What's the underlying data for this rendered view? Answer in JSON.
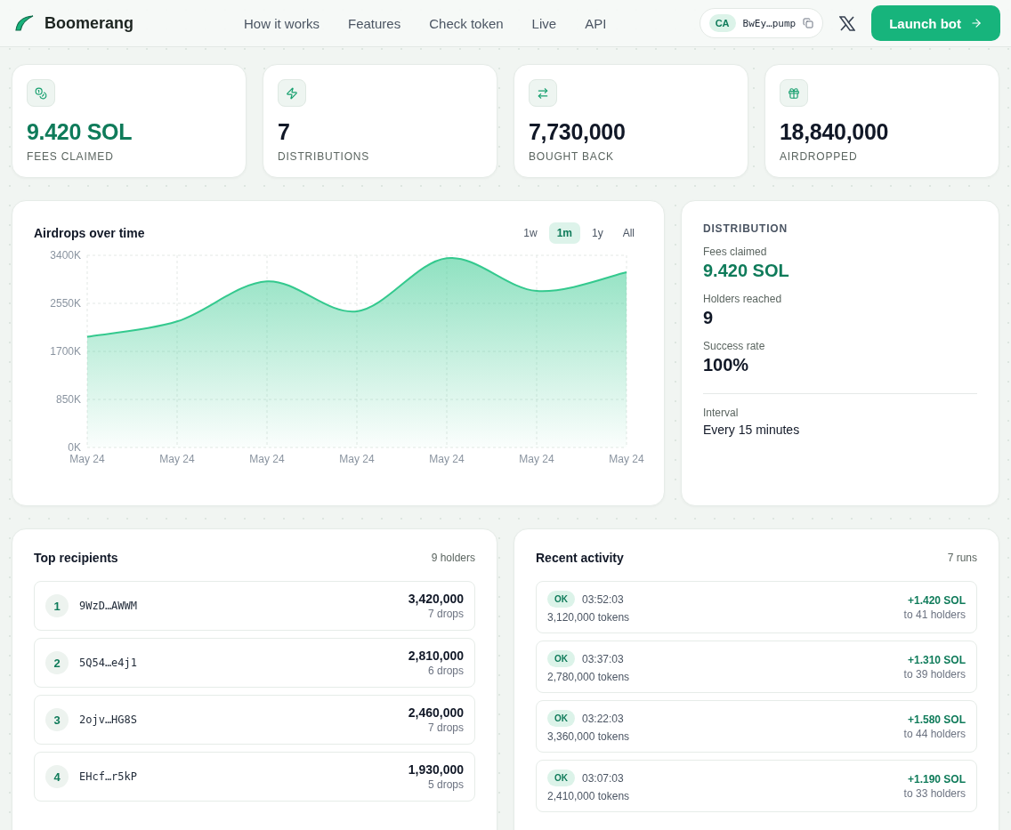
{
  "header": {
    "brand": "Boomerang",
    "nav": [
      {
        "label": "How it works"
      },
      {
        "label": "Features"
      },
      {
        "label": "Check token"
      },
      {
        "label": "Live"
      },
      {
        "label": "API"
      }
    ],
    "contract": {
      "badge": "CA",
      "address": "BwEy…pump"
    },
    "launch_button": "Launch bot"
  },
  "stats": [
    {
      "kind": "coins",
      "value": "9.420 SOL",
      "label": "FEES CLAIMED",
      "color": "#0f7b5a"
    },
    {
      "kind": "zap",
      "value": "7",
      "label": "DISTRIBUTIONS",
      "color": "#111827"
    },
    {
      "kind": "swap",
      "value": "7,730,000",
      "label": "BOUGHT BACK",
      "color": "#111827"
    },
    {
      "kind": "gift",
      "value": "18,840,000",
      "label": "AIRDROPPED",
      "color": "#111827"
    }
  ],
  "chart_card": {
    "title": "Airdrops over time",
    "ranges": [
      {
        "label": "1w",
        "selected": false
      },
      {
        "label": "1m",
        "selected": true
      },
      {
        "label": "1y",
        "selected": false
      },
      {
        "label": "All",
        "selected": false
      }
    ],
    "chart_data": {
      "type": "area",
      "categories": [
        "May 24",
        "May 24",
        "May 24",
        "May 24",
        "May 24",
        "May 24",
        "May 24"
      ],
      "grid": true,
      "series": [
        {
          "color": "#34c98e",
          "values": [
            1960,
            2230,
            2940,
            2410,
            3350,
            2770,
            3100
          ]
        }
      ],
      "ylim": [
        0,
        3400
      ],
      "yticks": [
        {
          "value": 0,
          "label": "0K"
        },
        {
          "value": 850,
          "label": "850K"
        },
        {
          "value": 1700,
          "label": "1700K"
        },
        {
          "value": 2550,
          "label": "2550K"
        },
        {
          "value": 3400,
          "label": "3400K"
        }
      ]
    }
  },
  "distribution": {
    "title": "DISTRIBUTION",
    "metrics": [
      {
        "label": "Fees claimed",
        "value": "9.420 SOL",
        "color": "#0f7b5a"
      },
      {
        "label": "Holders reached",
        "value": "9",
        "color": "#111827"
      },
      {
        "label": "Success rate",
        "value": "100%",
        "color": "#111827"
      }
    ],
    "interval": {
      "label": "Interval",
      "value": "Every 15 minutes"
    }
  },
  "recipients": {
    "title": "Top recipients",
    "count": "9 holders",
    "items": [
      {
        "rank": "1",
        "address": "9WzD…AWWM",
        "amount": "3,420,000",
        "drops": "7 drops"
      },
      {
        "rank": "2",
        "address": "5Q54…e4j1",
        "amount": "2,810,000",
        "drops": "6 drops"
      },
      {
        "rank": "3",
        "address": "2ojv…HG8S",
        "amount": "2,460,000",
        "drops": "7 drops"
      },
      {
        "rank": "4",
        "address": "EHcf…r5kP",
        "amount": "1,930,000",
        "drops": "5 drops"
      }
    ]
  },
  "activity": {
    "title": "Recent activity",
    "count": "7 runs",
    "items": [
      {
        "status": "OK",
        "time": "03:52:03",
        "tokens": "3,120,000 tokens",
        "sol": "+1.420 SOL",
        "holders": "to 41 holders"
      },
      {
        "status": "OK",
        "time": "03:37:03",
        "tokens": "2,780,000 tokens",
        "sol": "+1.310 SOL",
        "holders": "to 39 holders"
      },
      {
        "status": "OK",
        "time": "03:22:03",
        "tokens": "3,360,000 tokens",
        "sol": "+1.580 SOL",
        "holders": "to 44 holders"
      },
      {
        "status": "OK",
        "time": "03:07:03",
        "tokens": "2,410,000 tokens",
        "sol": "+1.190 SOL",
        "holders": "to 33 holders"
      }
    ]
  }
}
